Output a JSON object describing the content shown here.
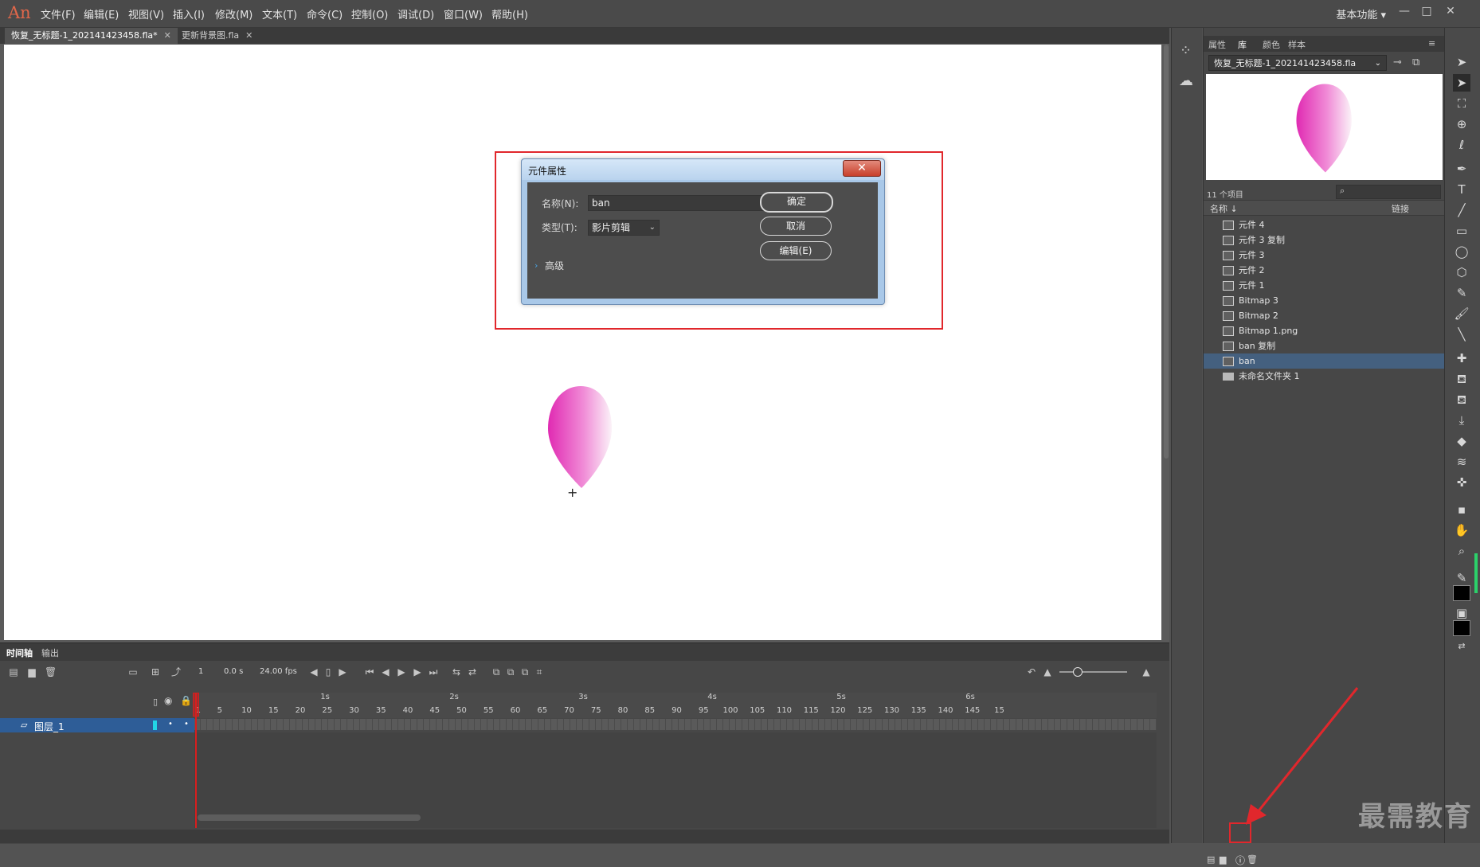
{
  "app": {
    "logo": "An",
    "menu": [
      "文件(F)",
      "编辑(E)",
      "视图(V)",
      "插入(I)",
      "修改(M)",
      "文本(T)",
      "命令(C)",
      "控制(O)",
      "调试(D)",
      "窗口(W)",
      "帮助(H)"
    ],
    "workspace": "基本功能 ▾",
    "window_buttons": [
      "—",
      "□",
      "✕"
    ]
  },
  "doc_tabs": [
    {
      "label": "恢复_无标题-1_202141423458.fla*",
      "active": true
    },
    {
      "label": "更新背景图.fla",
      "active": false
    }
  ],
  "dialog": {
    "title": "元件属性",
    "close": "✕",
    "name_label": "名称(N):",
    "name_value": "ban",
    "type_label": "类型(T):",
    "type_value": "影片剪辑",
    "ok": "确定",
    "cancel": "取消",
    "edit": "编辑(E)",
    "advanced": "高级"
  },
  "stage": {
    "crosshair": "+"
  },
  "petal": {
    "color_dark": "#e02ab2",
    "color_light": "#fbf2f8"
  },
  "timeline": {
    "tabs": [
      "时间轴",
      "输出"
    ],
    "frame_readout": "1",
    "time_readout": "0.0 s",
    "fps_readout": "24.00 fps",
    "layer_name": "图层_1",
    "ruler_seconds": [
      "1s",
      "2s",
      "3s",
      "4s",
      "5s",
      "6s"
    ],
    "ruler_numbers": [
      "1",
      "5",
      "10",
      "15",
      "20",
      "25",
      "30",
      "35",
      "40",
      "45",
      "50",
      "55",
      "60",
      "65",
      "70",
      "75",
      "80",
      "85",
      "90",
      "95",
      "100",
      "105",
      "110",
      "115",
      "120",
      "125",
      "130",
      "135",
      "140",
      "145",
      "15"
    ]
  },
  "library": {
    "tabs": [
      "属性",
      "库",
      "颜色",
      "样本"
    ],
    "active_tab": "库",
    "doc_name": "恢复_无标题-1_202141423458.fla",
    "count": "11 个项目",
    "col_name": "名称 ↓",
    "col_link": "链接",
    "items": [
      {
        "label": "元件 4",
        "kind": "symbol"
      },
      {
        "label": "元件 3 复制",
        "kind": "symbol"
      },
      {
        "label": "元件 3",
        "kind": "symbol"
      },
      {
        "label": "元件 2",
        "kind": "symbol"
      },
      {
        "label": "元件 1",
        "kind": "symbol"
      },
      {
        "label": "Bitmap 3",
        "kind": "bitmap"
      },
      {
        "label": "Bitmap 2",
        "kind": "bitmap"
      },
      {
        "label": "Bitmap 1.png",
        "kind": "bitmap"
      },
      {
        "label": "ban 复制",
        "kind": "symbol"
      },
      {
        "label": "ban",
        "kind": "symbol",
        "selected": true
      },
      {
        "label": "未命名文件夹 1",
        "kind": "folder"
      }
    ]
  },
  "watermark": "最需教育",
  "colors": {
    "accent_red": "#e1272c",
    "selection": "#2e5d97"
  }
}
